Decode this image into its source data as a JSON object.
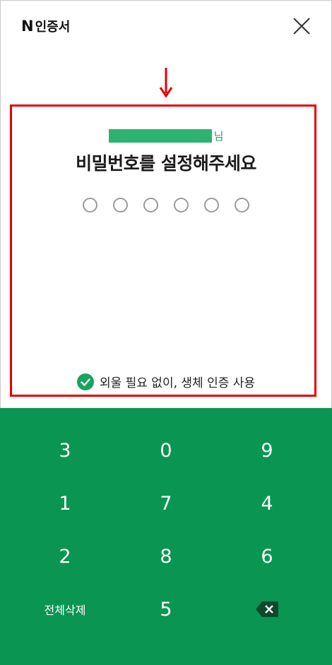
{
  "header": {
    "logo_mark": "N",
    "logo_text": "인증서"
  },
  "prompt": {
    "name_suffix": "님",
    "title": "비밀번호를 설정해주세요",
    "pin_length": 6,
    "pin_filled": 0
  },
  "biometric": {
    "label": "외울 필요 없이, 생체 인증 사용",
    "checked": true
  },
  "keypad": {
    "rows": [
      [
        "3",
        "0",
        "9"
      ],
      [
        "1",
        "7",
        "4"
      ],
      [
        "2",
        "8",
        "6"
      ]
    ],
    "clear_label": "전체삭제",
    "last_digit": "5"
  },
  "icons": {
    "close": "close-icon",
    "arrow": "arrow-down-icon",
    "check": "check-circle-icon",
    "backspace": "backspace-icon"
  },
  "colors": {
    "accent_green": "#0a9552",
    "name_green": "#2db36e",
    "highlight_red": "#e50000"
  }
}
